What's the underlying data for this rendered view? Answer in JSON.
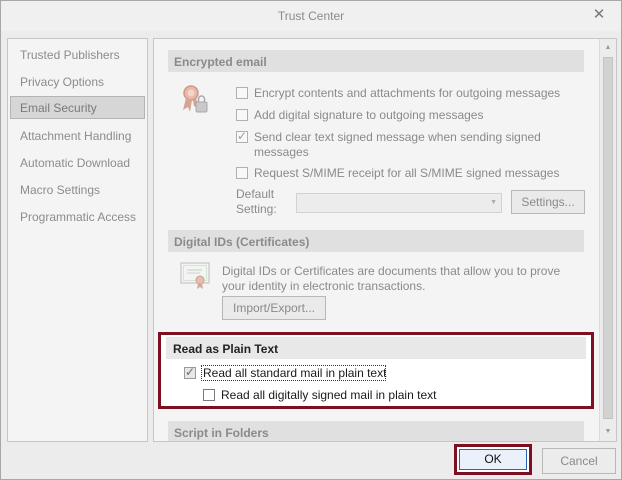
{
  "window": {
    "title": "Trust Center"
  },
  "nav": {
    "items": [
      {
        "label": "Trusted Publishers",
        "selected": false
      },
      {
        "label": "Privacy Options",
        "selected": false
      },
      {
        "label": "Email Security",
        "selected": true
      },
      {
        "label": "Attachment Handling",
        "selected": false
      },
      {
        "label": "Automatic Download",
        "selected": false
      },
      {
        "label": "Macro Settings",
        "selected": false
      },
      {
        "label": "Programmatic Access",
        "selected": false
      }
    ]
  },
  "encrypted_email": {
    "header": "Encrypted email",
    "options": [
      {
        "label": "Encrypt contents and attachments for outgoing messages",
        "checked": false
      },
      {
        "label": "Add digital signature to outgoing messages",
        "checked": false
      },
      {
        "label": "Send clear text signed message when sending signed",
        "label_line2": "messages",
        "checked": true
      },
      {
        "label": "Request S/MIME receipt for all S/MIME signed messages",
        "checked": false
      }
    ],
    "default_setting_label_line1": "Default",
    "default_setting_label_line2": "Setting:",
    "default_setting_value": "",
    "settings_button": "Settings..."
  },
  "digital_ids": {
    "header": "Digital IDs (Certificates)",
    "description_line1": "Digital IDs or Certificates are documents that allow you to prove",
    "description_line2": "your identity in electronic transactions.",
    "import_export_button": "Import/Export..."
  },
  "plain_text": {
    "header": "Read as Plain Text",
    "options": [
      {
        "label": "Read all standard mail in plain text",
        "checked": true
      },
      {
        "label": "Read all digitally signed mail in plain text",
        "checked": false
      }
    ]
  },
  "script_in_folders": {
    "header": "Script in Folders"
  },
  "footer": {
    "ok_label": "OK",
    "cancel_label": "Cancel"
  },
  "colors": {
    "highlight": "#7b1020",
    "focus_blue": "#2a62b8"
  }
}
